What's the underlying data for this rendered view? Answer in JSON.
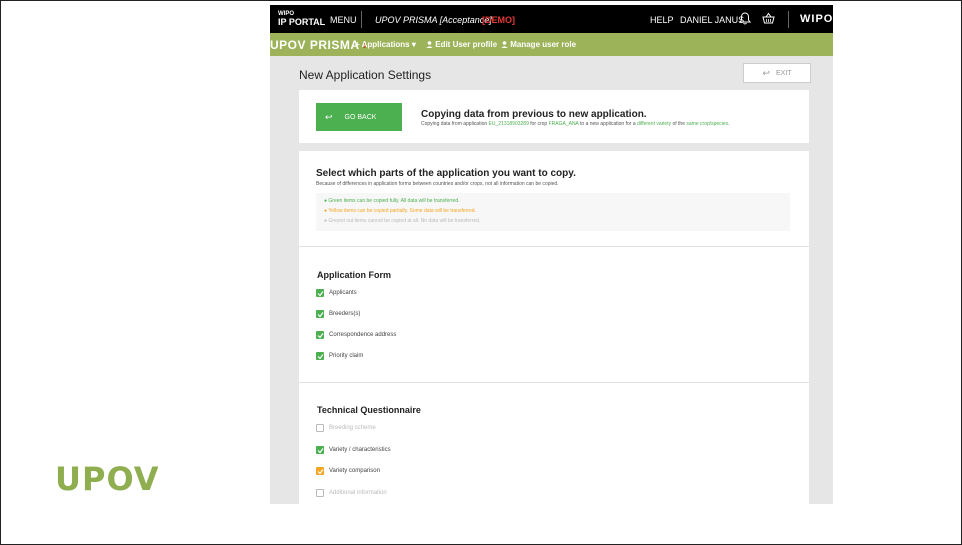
{
  "logo": {
    "text": "UPOV"
  },
  "topbar": {
    "wipo_small": "WIPO",
    "ip_portal": "IP PORTAL",
    "menu": "MENU",
    "app_name": "UPOV PRISMA [Acceptance]",
    "demo": "[DEMO]",
    "help": "HELP",
    "user": "DANIEL JANUS",
    "wipo": "WIPO",
    "icons": [
      "bell-icon",
      "basket-icon"
    ]
  },
  "nav": {
    "brand": "UPOV PRISMA",
    "applications": "+ Applications",
    "edit_profile": "Edit User profile",
    "manage_role": "Manage user role"
  },
  "page": {
    "title": "New Application Settings",
    "exit": "EXIT"
  },
  "copy_card": {
    "go_back": "GO BACK",
    "title": "Copying data from previous to new application.",
    "sub_prefix": "Copying data from application ",
    "app_id": "EU_21318903289",
    "sub_mid1": " for crop ",
    "crop": "FRAGA_ANA",
    "sub_mid2": " to a new application for a ",
    "different": "different variety",
    "sub_mid3": " of the ",
    "same": "same crop/species",
    "sub_end": "."
  },
  "select_section": {
    "title": "Select which parts of the application you want to copy.",
    "subtitle": "Because of differences in application forms between countries and/or crops, not all information can be copied.",
    "legend": [
      {
        "text": "Green items can be copied fully. All data will be transferred.",
        "color": "#4caf50"
      },
      {
        "text": "Yellow items can be copied partially. Some data will be transferred.",
        "color": "#f5a623"
      },
      {
        "text": "Greyed out items cannot be copied at all. No data will be transferred.",
        "color": "#bbbbbb"
      }
    ]
  },
  "application_form": {
    "title": "Application Form",
    "items": [
      {
        "label": "Applicants",
        "state": "green"
      },
      {
        "label": "Breeders(s)",
        "state": "green"
      },
      {
        "label": "Correspondence address",
        "state": "green"
      },
      {
        "label": "Priority claim",
        "state": "green"
      }
    ]
  },
  "technical_questionnaire": {
    "title": "Technical Questionnaire",
    "items": [
      {
        "label": "Breeding scheme",
        "state": "grey"
      },
      {
        "label": "Variety / characteristics",
        "state": "green"
      },
      {
        "label": "Variety comparison",
        "state": "orange"
      },
      {
        "label": "Additional information",
        "state": "grey"
      }
    ]
  }
}
